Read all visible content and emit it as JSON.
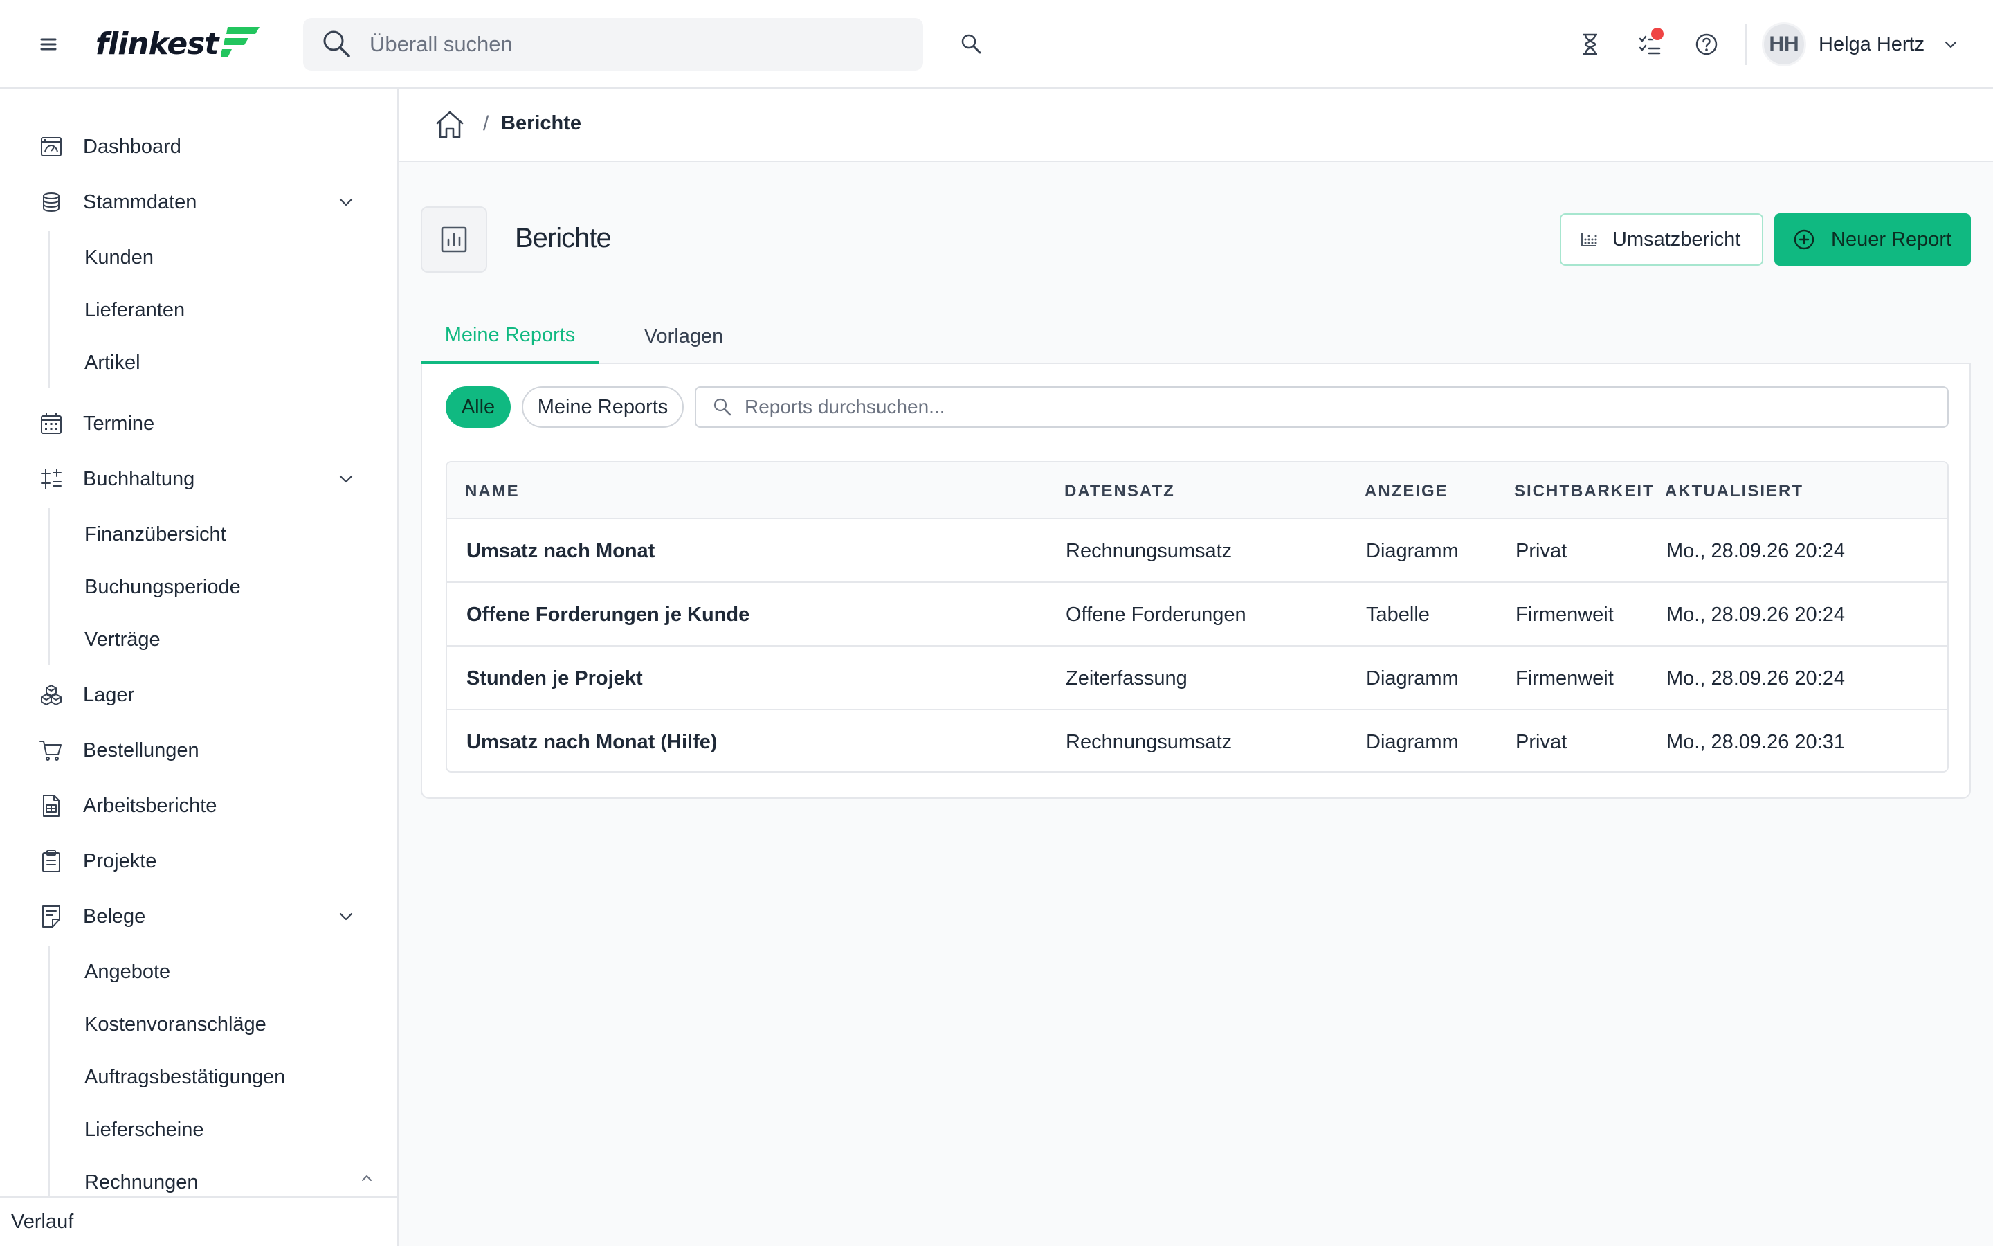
{
  "app": {
    "logo_text": "flinkest",
    "accent_color": "#10b981"
  },
  "topbar": {
    "search_placeholder": "Überall suchen",
    "user": {
      "initials": "HH",
      "name": "Helga Hertz"
    },
    "icons": [
      "menu-icon",
      "search-icon",
      "hourglass-icon",
      "task-list-icon",
      "help-icon",
      "chevron-down-icon"
    ]
  },
  "sidebar": {
    "items": [
      {
        "label": "Dashboard",
        "icon": "dashboard-icon"
      },
      {
        "label": "Stammdaten",
        "icon": "database-icon",
        "expanded": true,
        "children": [
          "Kunden",
          "Lieferanten",
          "Artikel"
        ]
      },
      {
        "label": "Termine",
        "icon": "calendar-icon"
      },
      {
        "label": "Buchhaltung",
        "icon": "sliders-icon",
        "expanded": true,
        "children": [
          "Finanzübersicht",
          "Buchungsperiode",
          "Verträge"
        ]
      },
      {
        "label": "Lager",
        "icon": "boxes-icon"
      },
      {
        "label": "Bestellungen",
        "icon": "cart-icon"
      },
      {
        "label": "Arbeitsberichte",
        "icon": "worksheet-icon"
      },
      {
        "label": "Projekte",
        "icon": "clipboard-icon"
      },
      {
        "label": "Belege",
        "icon": "receipt-icon",
        "expanded": true,
        "children": [
          "Angebote",
          "Kostenvoranschläge",
          "Auftragsbestätigungen",
          "Lieferscheine",
          "Rechnungen"
        ]
      }
    ],
    "footer_label": "Verlauf"
  },
  "breadcrumb": {
    "separator": "/",
    "current": "Berichte"
  },
  "page": {
    "title": "Berichte",
    "actions": {
      "secondary": "Umsatzbericht",
      "primary": "Neuer Report"
    },
    "tabs": [
      {
        "label": "Meine Reports",
        "active": true
      },
      {
        "label": "Vorlagen",
        "active": false
      }
    ],
    "filters": {
      "chips": [
        {
          "label": "Alle",
          "active": true
        },
        {
          "label": "Meine Reports",
          "active": false
        }
      ],
      "search_placeholder": "Reports durchsuchen..."
    },
    "table": {
      "columns": [
        "NAME",
        "DATENSATZ",
        "ANZEIGE",
        "SICHTBARKEIT",
        "AKTUALISIERT"
      ],
      "rows": [
        [
          "Umsatz nach Monat",
          "Rechnungsumsatz",
          "Diagramm",
          "Privat",
          "Mo., 28.09.26 20:24"
        ],
        [
          "Offene Forderungen je Kunde",
          "Offene Forderungen",
          "Tabelle",
          "Firmenweit",
          "Mo., 28.09.26 20:24"
        ],
        [
          "Stunden je Projekt",
          "Zeiterfassung",
          "Diagramm",
          "Firmenweit",
          "Mo., 28.09.26 20:24"
        ],
        [
          "Umsatz nach Monat (Hilfe)",
          "Rechnungsumsatz",
          "Diagramm",
          "Privat",
          "Mo., 28.09.26 20:31"
        ]
      ]
    }
  }
}
